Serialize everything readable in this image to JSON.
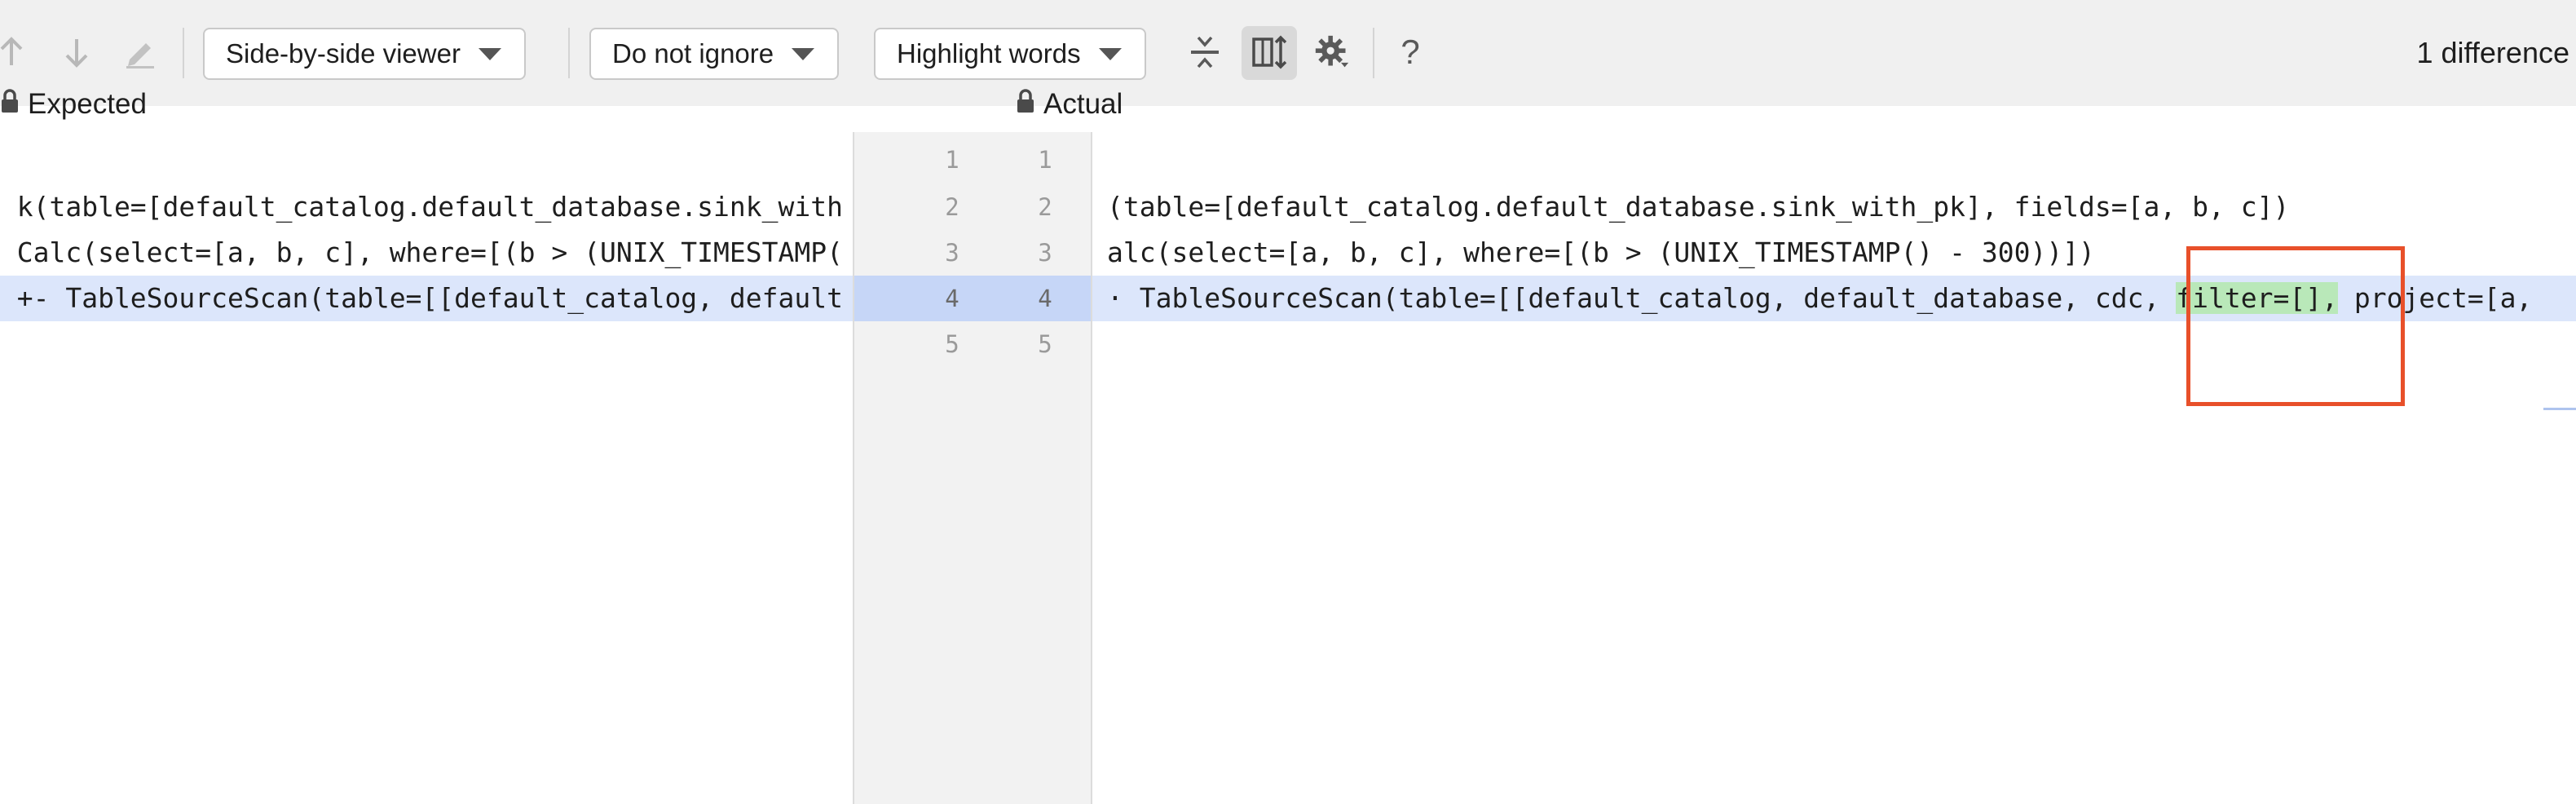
{
  "toolbar": {
    "icons": {
      "prev": "arrow-up-icon",
      "next": "arrow-down-icon",
      "edit": "pencil-icon",
      "collapse": "collapse-lines-icon",
      "sync_scroll": "sync-scroll-icon",
      "settings": "gear-icon",
      "help": "help-icon"
    },
    "viewer_label": "Side-by-side viewer",
    "ignore_label": "Do not ignore",
    "highlight_label": "Highlight words",
    "help_glyph": "?",
    "difference_count": "1 difference"
  },
  "left_pane": {
    "title": "Expected",
    "lines": [
      "",
      "k(table=[default_catalog.default_database.sink_with",
      "Calc(select=[a, b, c], where=[(b > (UNIX_TIMESTAMP(",
      "+- TableSourceScan(table=[[default_catalog, default",
      ""
    ]
  },
  "gutter": {
    "left_numbers": [
      "1",
      "2",
      "3",
      "4",
      "5"
    ],
    "right_numbers": [
      "1",
      "2",
      "3",
      "4",
      "5"
    ]
  },
  "right_pane": {
    "title": "Actual",
    "lines": [
      "",
      "(table=[default_catalog.default_database.sink_with_pk], fields=[a, b, c])",
      "alc(select=[a, b, c], where=[(b > (UNIX_TIMESTAMP() - 300))])",
      "",
      ""
    ],
    "changed_line": {
      "before": "· TableSourceScan(table=[[default_catalog, default_database, cdc, ",
      "highlight": "filter=[],",
      "after": " project=[a,"
    }
  },
  "colors": {
    "changed_line_bg": "#dce6fb",
    "word_highlight": "#b9e8b9",
    "annotation_box": "#e8502a"
  }
}
